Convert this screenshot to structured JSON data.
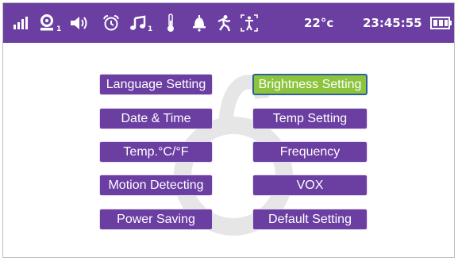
{
  "status_bar": {
    "icons": [
      "signal-strength-icon",
      "camera-icon",
      "volume-icon",
      "alarm-clock-icon",
      "lullaby-music-icon",
      "thermometer-icon",
      "bell-icon",
      "motion-icon",
      "feeding-icon",
      "battery-icon"
    ],
    "camera_index": "1",
    "music_index": "1",
    "temperature": "22°c",
    "time": "23:45:55"
  },
  "menu": {
    "items": [
      {
        "label": "Language Setting",
        "selected": false
      },
      {
        "label": "Brightness Setting",
        "selected": true
      },
      {
        "label": "Date & Time",
        "selected": false
      },
      {
        "label": "Temp Setting",
        "selected": false
      },
      {
        "label": "Temp.°C/°F",
        "selected": false
      },
      {
        "label": "Frequency",
        "selected": false
      },
      {
        "label": "Motion Detecting",
        "selected": false
      },
      {
        "label": "VOX",
        "selected": false
      },
      {
        "label": "Power Saving",
        "selected": false
      },
      {
        "label": "Default Setting",
        "selected": false
      }
    ]
  },
  "colors": {
    "bar": "#6b3ea2",
    "button": "#6b3ea2",
    "selected_button": "#8cc43e",
    "selected_border": "#2f5f9a",
    "watermark": "#e6e6e6"
  }
}
